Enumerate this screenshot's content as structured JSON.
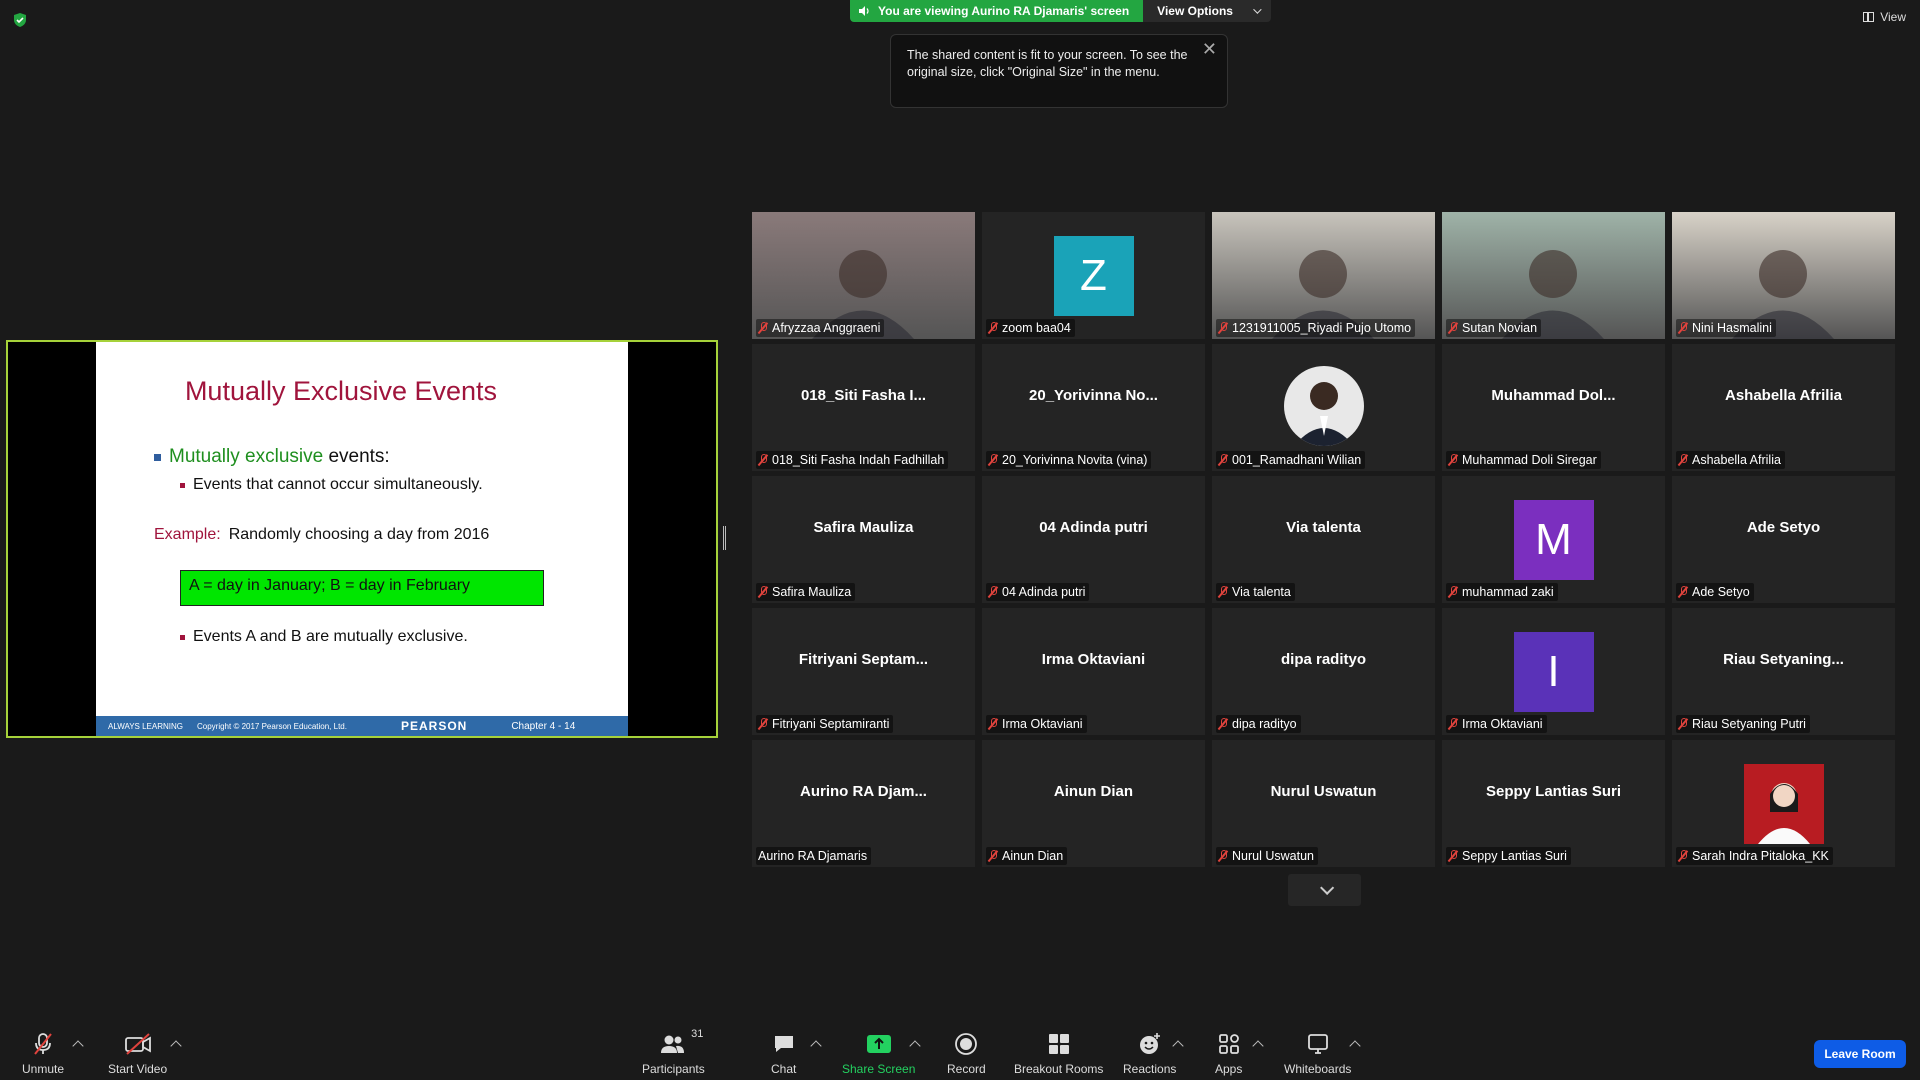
{
  "top": {
    "viewing_text": "You are viewing Aurino RA Djamaris' screen",
    "view_options": "View Options",
    "tooltip": "The shared content is fit to your screen. To see the original size, click \"Original Size\" in the menu.",
    "tooltip_close": "✕",
    "view": "View"
  },
  "slide": {
    "title": "Mutually Exclusive Events",
    "bullet1_green": "Mutually exclusive",
    "bullet1_rest": " events:",
    "bullet2": "Events that cannot occur simultaneously.",
    "example_label": "Example:",
    "example_text": "Randomly choosing a day from 2016",
    "box_text": "A = day in January;  B = day in February",
    "bullet3": "Events A and B are mutually exclusive.",
    "footer_left": "ALWAYS LEARNING",
    "footer_copy": "Copyright © 2017 Pearson Education, Ltd.",
    "footer_brand": "PEARSON",
    "footer_chapter": "Chapter 4 - 14"
  },
  "participants": [
    {
      "label": "Afryzzaa Anggraeni",
      "center": "",
      "type": "photo",
      "color": "#8a7a7a",
      "muted": true
    },
    {
      "label": "zoom baa04",
      "center": "",
      "type": "avatar",
      "letter": "Z",
      "color": "#1aa3b8",
      "muted": true
    },
    {
      "label": "1231911005_Riyadi Pujo Utomo",
      "center": "",
      "type": "photo",
      "color": "#c8c4bc",
      "muted": true
    },
    {
      "label": "Sutan Novian",
      "center": "",
      "type": "photo",
      "color": "#9fb3a8",
      "muted": true
    },
    {
      "label": "Nini Hasmalini",
      "center": "",
      "type": "photo",
      "color": "#d8d2c8",
      "muted": true,
      "active": true
    },
    {
      "label": "018_Siti Fasha Indah Fadhillah",
      "center": "018_Siti  Fasha  I...",
      "type": "name",
      "muted": true
    },
    {
      "label": "20_Yorivinna Novita (vina)",
      "center": "20_Yorivinna  No...",
      "type": "name",
      "muted": true
    },
    {
      "label": "001_Ramadhani Wilian",
      "center": "",
      "type": "round-photo",
      "color": "#e8e8e8",
      "muted": true
    },
    {
      "label": "Muhammad Doli Siregar",
      "center": "Muhammad  Dol...",
      "type": "name",
      "muted": true
    },
    {
      "label": "Ashabella Afrilia",
      "center": "Ashabella Afrilia",
      "type": "name",
      "muted": true
    },
    {
      "label": "Safira Mauliza",
      "center": "Safira Mauliza",
      "type": "name",
      "muted": true
    },
    {
      "label": "04 Adinda putri",
      "center": "04 Adinda putri",
      "type": "name",
      "muted": true
    },
    {
      "label": "Via talenta",
      "center": "Via talenta",
      "type": "name",
      "muted": true
    },
    {
      "label": "muhammad zaki",
      "center": "",
      "type": "avatar",
      "letter": "M",
      "color": "#7b2fbf",
      "muted": true
    },
    {
      "label": "Ade Setyo",
      "center": "Ade Setyo",
      "type": "name",
      "muted": true
    },
    {
      "label": "Fitriyani Septamiranti",
      "center": "Fitriyani  Septam...",
      "type": "name",
      "muted": true
    },
    {
      "label": "Irma Oktaviani",
      "center": "Irma Oktaviani",
      "type": "name",
      "muted": true
    },
    {
      "label": "dipa radityo",
      "center": "dipa radityo",
      "type": "name",
      "muted": true
    },
    {
      "label": "Irma Oktaviani",
      "center": "",
      "type": "avatar",
      "letter": "I",
      "color": "#5a32b8",
      "muted": true
    },
    {
      "label": "Riau Setyaning Putri",
      "center": "Riau  Setyaning...",
      "type": "name",
      "muted": true
    },
    {
      "label": "Aurino RA Djamaris",
      "center": "Aurino  RA  Djam...",
      "type": "name",
      "muted": false
    },
    {
      "label": "Ainun Dian",
      "center": "Ainun Dian",
      "type": "name",
      "muted": true
    },
    {
      "label": "Nurul Uswatun",
      "center": "Nurul Uswatun",
      "type": "name",
      "muted": true
    },
    {
      "label": "Seppy Lantias Suri",
      "center": "Seppy Lantias Suri",
      "type": "name",
      "muted": true
    },
    {
      "label": "Sarah Indra Pitaloka_KK",
      "center": "",
      "type": "square-photo",
      "color": "#b81c22",
      "muted": true
    }
  ],
  "toolbar": {
    "unmute": "Unmute",
    "start_video": "Start Video",
    "participants": "Participants",
    "participants_count": "31",
    "chat": "Chat",
    "share_screen": "Share Screen",
    "record": "Record",
    "breakout": "Breakout Rooms",
    "reactions": "Reactions",
    "apps": "Apps",
    "whiteboards": "Whiteboards",
    "leave": "Leave Room"
  },
  "colors": {
    "accent_green": "#23a641",
    "active_border": "#cfe04a",
    "leave_blue": "#0e5ce6",
    "muted_red": "#e0433d"
  }
}
